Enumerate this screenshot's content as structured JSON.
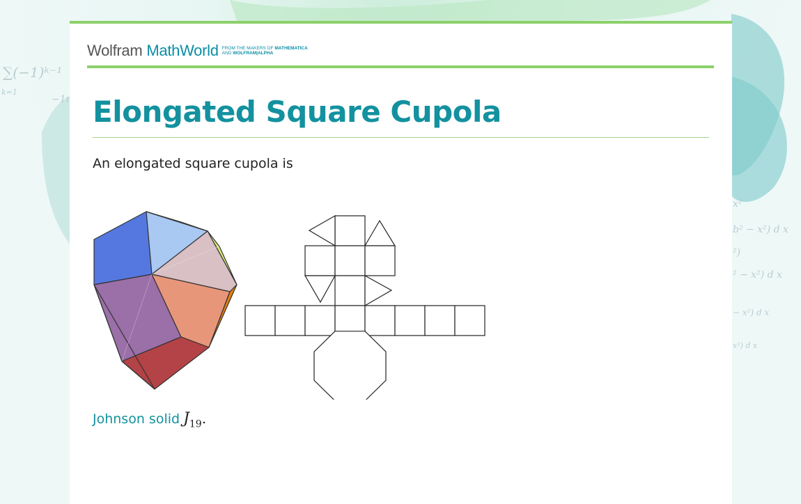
{
  "header": {
    "logo_wolfram": "Wolfram",
    "logo_mathworld": "MathWorld",
    "tagline_line1_prefix": "FROM THE MAKERS OF ",
    "tagline_line1_bold": "MATHEMATICA",
    "tagline_line2_prefix": "AND ",
    "tagline_line2_bold": "WOLFRAM|ALPHA"
  },
  "article": {
    "title": "Elongated Square Cupola",
    "intro": "An elongated square cupola is",
    "caption_link": "Johnson solid",
    "caption_math": "J",
    "caption_subscript": "19",
    "caption_end": "."
  },
  "colors": {
    "accent_green": "#8cd16a",
    "link_teal": "#13919f",
    "brand_teal": "#0a8ea6"
  },
  "background_formulas": {
    "left_sum": "∑(−1)ᵏ⁻¹",
    "left_sub": "k=1",
    "left_tail": "−1r",
    "right_1": "x²",
    "right_2": "b² − x²)  d x",
    "right_3": "²)",
    "right_4": "² − x²)  d x",
    "right_5": "− x²)  d x",
    "right_6": "x²)  d x"
  }
}
